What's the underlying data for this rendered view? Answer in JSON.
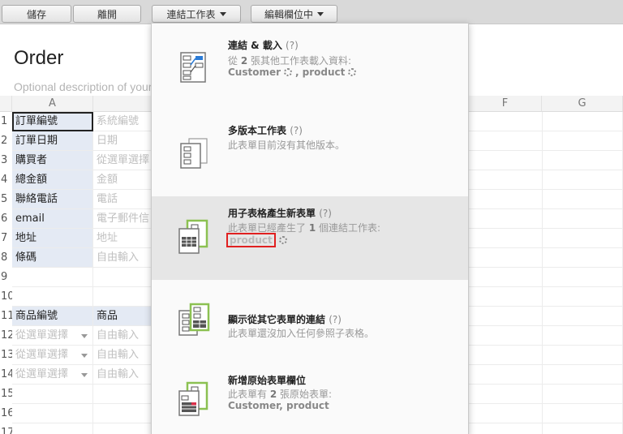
{
  "toolbar": {
    "save_label": "儲存",
    "leave_label": "離開",
    "link_sheet_label": "連結工作表",
    "edit_field_label": "編輯欄位中"
  },
  "form": {
    "title": "Order",
    "description_placeholder": "Optional description of your"
  },
  "grid": {
    "columns": [
      "A",
      "",
      "F",
      "G"
    ],
    "row_numbers": [
      "1",
      "2",
      "3",
      "4",
      "5",
      "6",
      "7",
      "8",
      "9",
      "10",
      "11",
      "12",
      "13",
      "14",
      "15",
      "16",
      "17"
    ],
    "field_labels": [
      "訂單編號",
      "訂單日期",
      "購買者",
      "總金額",
      "聯絡電話",
      "email",
      "地址",
      "條碼"
    ],
    "field_types": [
      "系統編號",
      "日期",
      "從選單選擇",
      "金額",
      "電話",
      "電子郵件信",
      "地址",
      "自由輸入"
    ],
    "subtable_headers": [
      "商品編號",
      "商品"
    ],
    "subtable_rows": [
      [
        "從選單選擇",
        "自由輸入"
      ],
      [
        "從選單選擇",
        "自由輸入"
      ],
      [
        "從選單選擇",
        "自由輸入"
      ]
    ]
  },
  "dropdown": {
    "items": [
      {
        "title": "連結 & 載入",
        "help": "(?)",
        "desc_prefix": "從",
        "desc_count": "2",
        "desc_suffix": "張其他工作表載入資料:",
        "link1": "Customer",
        "link2": "product",
        "icon": "link-load-icon"
      },
      {
        "title": "多版本工作表",
        "help": "(?)",
        "desc": "此表單目前沒有其他版本。",
        "icon": "multi-version-icon"
      },
      {
        "title": "用子表格產生新表單",
        "help": "(?)",
        "desc_prefix": "此表單已經產生了",
        "desc_count": "1",
        "desc_suffix": "個連結工作表:",
        "link1": "product",
        "icon": "subtable-new-form-icon"
      },
      {
        "title": "顯示從其它表單的連結",
        "help": "(?)",
        "desc": "此表單還沒加入任何參照子表格。",
        "icon": "show-links-icon"
      },
      {
        "title": "新增原始表單欄位",
        "help": "",
        "desc_prefix": "此表單有",
        "desc_count": "2",
        "desc_suffix": "張原始表單:",
        "links_text": "Customer, product",
        "icon": "source-form-icon"
      }
    ]
  },
  "colors": {
    "label_bg": "#e4eaf4",
    "highlight_red": "#e02020",
    "icon_green": "#8cc152",
    "icon_blue": "#2b7bd6"
  }
}
